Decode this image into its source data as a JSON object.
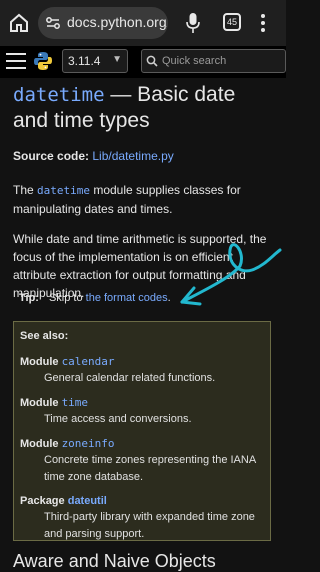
{
  "browser": {
    "url": "docs.python.org/",
    "tab_count": "45"
  },
  "nav": {
    "version": "3.11.4",
    "search_placeholder": "Quick search"
  },
  "page": {
    "title_code": "datetime",
    "title_rest": " — Basic date and time types",
    "source_label": "Source code:",
    "source_link": "Lib/datetime.py",
    "intro_pre": "The ",
    "intro_code": "datetime",
    "intro_post": " module supplies classes for manipulating dates and times.",
    "para2": "While date and time arithmetic is supported, the focus of the implementation is on efficient attribute extraction for output formatting and manipulation.",
    "tip_label": "Tip:",
    "tip_text": "Skip to ",
    "tip_link": "the format codes",
    "tip_end": "."
  },
  "see_also": {
    "heading": "See also:",
    "entries": [
      {
        "kind": "Module",
        "name": "calendar",
        "desc": "General calendar related functions."
      },
      {
        "kind": "Module",
        "name": "time",
        "desc": "Time access and conversions."
      },
      {
        "kind": "Module",
        "name": "zoneinfo",
        "desc": "Concrete time zones representing the IANA time zone database."
      },
      {
        "kind": "Package",
        "name": "dateutil",
        "desc": "Third-party library with expanded time zone and parsing support."
      }
    ]
  },
  "next_section": "Aware and Naive Objects",
  "colors": {
    "link": "#79aafd",
    "annotation": "#22b8cf"
  }
}
